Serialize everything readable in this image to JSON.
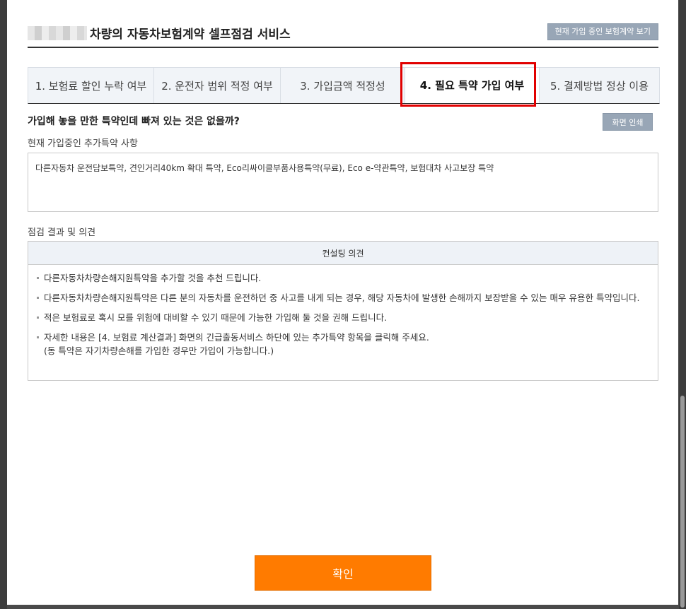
{
  "header": {
    "title": "차량의 자동차보험계약 셀프점검 서비스",
    "view_contract_button": "현재 가입 중인 보험계약 보기"
  },
  "tabs": [
    {
      "label": "1. 보험료 할인 누락 여부"
    },
    {
      "label": "2. 운전자 범위 적정 여부"
    },
    {
      "label": "3. 가입금액 적정성"
    },
    {
      "label": "4. 필요 특약 가입 여부",
      "active": true
    },
    {
      "label": "5. 결제방법 정상 이용"
    }
  ],
  "question": "가입해 놓을 만한 특약인데 빠져 있는 것은 없을까?",
  "print_button": "화면 인쇄",
  "current_section": {
    "label": "현재 가입중인 추가특약 사항",
    "text": "다른자동차 운전담보특약, 견인거리40km 확대 특약, Eco리싸이클부품사용특약(무료), Eco e-약관특약, 보험대차 사고보장 특약"
  },
  "result_section": {
    "label": "점검 결과 및 의견",
    "table_header": "컨설팅 의견",
    "items": [
      {
        "text": "다른자동차차량손해지원특약을 추가할 것을 추천 드립니다.",
        "line2": ""
      },
      {
        "text": "다른자동차차량손해지원특약은 다른 분의 자동차를 운전하던 중 사고를 내게 되는 경우, 해당 자동차에 발생한 손해까지 보장받을 수 있는 매우 유용한 특약입니다.",
        "line2": ""
      },
      {
        "text": "적은 보험료로 혹시 모를 위험에 대비할 수 있기 때문에 가능한 가입해 둘 것을 권해 드립니다.",
        "line2": ""
      },
      {
        "text": "자세한 내용은 [4. 보험료 계산결과] 화면의 긴급출동서비스 하단에 있는 추가특약 항목을 클릭해 주세요.",
        "line2": "(동 특약은 자기차량손해를 가입한 경우만 가입이 가능합니다.)"
      }
    ]
  },
  "confirm_button": "확인",
  "colors": {
    "accent_orange": "#ff7b00",
    "highlight_red": "#e10000",
    "gray_button": "#98a6b6"
  }
}
